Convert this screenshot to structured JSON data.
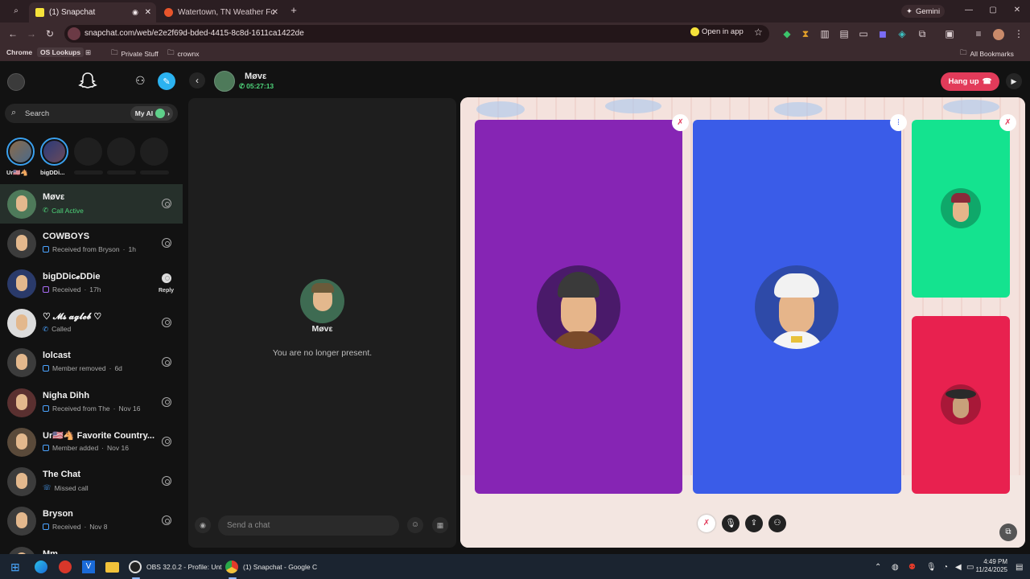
{
  "browser": {
    "tabs": [
      {
        "title": "(1) Snapchat",
        "active": true
      },
      {
        "title": "Watertown, TN Weather Forecast",
        "active": false
      }
    ],
    "url": "snapchat.com/web/e2e2f69d-bded-4415-8c8d-1611ca1422de",
    "open_in_app": "Open in app",
    "gemini": "Gemini",
    "bookmarks": [
      "Chrome",
      "OS Lookups",
      "Private Stuff",
      "crownx"
    ],
    "all_bookmarks": "All Bookmarks"
  },
  "app": {
    "search_placeholder": "Search",
    "my_ai": "My AI",
    "stories": [
      {
        "label": "Ur🇺🇸🐴"
      },
      {
        "label": "bigDDi..."
      }
    ],
    "conversations": [
      {
        "name": "Møvε",
        "status": "Call Active",
        "time": "",
        "selected": true,
        "kind": "call-active"
      },
      {
        "name": "COWBOYS",
        "status": "Received from Bryson",
        "time": "1h",
        "kind": "received"
      },
      {
        "name": "bigDDic𝓮DDie",
        "status": "Received",
        "time": "17h",
        "kind": "received-purple",
        "reply": "Reply"
      },
      {
        "name": "♡︎ 𝓜𝓼 𝓪𝓰𝓵𝓮𝓫 ♡︎",
        "status": "Called",
        "time": "",
        "kind": "called"
      },
      {
        "name": "lolcast",
        "status": "Member removed",
        "time": "6d",
        "kind": "received"
      },
      {
        "name": "Nigha Dihh",
        "status": "Received from The",
        "time": "Nov 16",
        "kind": "received"
      },
      {
        "name": "Ur🇺🇸🐴 Favorite Country...",
        "status": "Member added",
        "time": "Nov 16",
        "kind": "received"
      },
      {
        "name": "The Chat",
        "status": "Missed call",
        "time": "",
        "kind": "missed"
      },
      {
        "name": "Bryson",
        "status": "Received",
        "time": "Nov 8",
        "kind": "received"
      },
      {
        "name": "Mm...",
        "status": "",
        "time": "",
        "kind": "received"
      }
    ],
    "header": {
      "name": "Møvε",
      "call_timer": "05:27:13",
      "hang_up": "Hang up"
    },
    "chat": {
      "name": "Møvε",
      "notice": "You are no longer present.",
      "input_placeholder": "Send a chat"
    }
  },
  "taskbar": {
    "items": [
      "OBS 32.0.2 - Profile: Unt",
      "(1) Snapchat - Google C"
    ],
    "time": "4:49 PM",
    "date": "11/24/2025"
  },
  "colors": {
    "tile1": "#8625b4",
    "tile2": "#3a5ce8",
    "tile3": "#14e38f",
    "tile4": "#e8214f",
    "hangup": "#e23b5a",
    "accent": "#2bb2f0"
  }
}
